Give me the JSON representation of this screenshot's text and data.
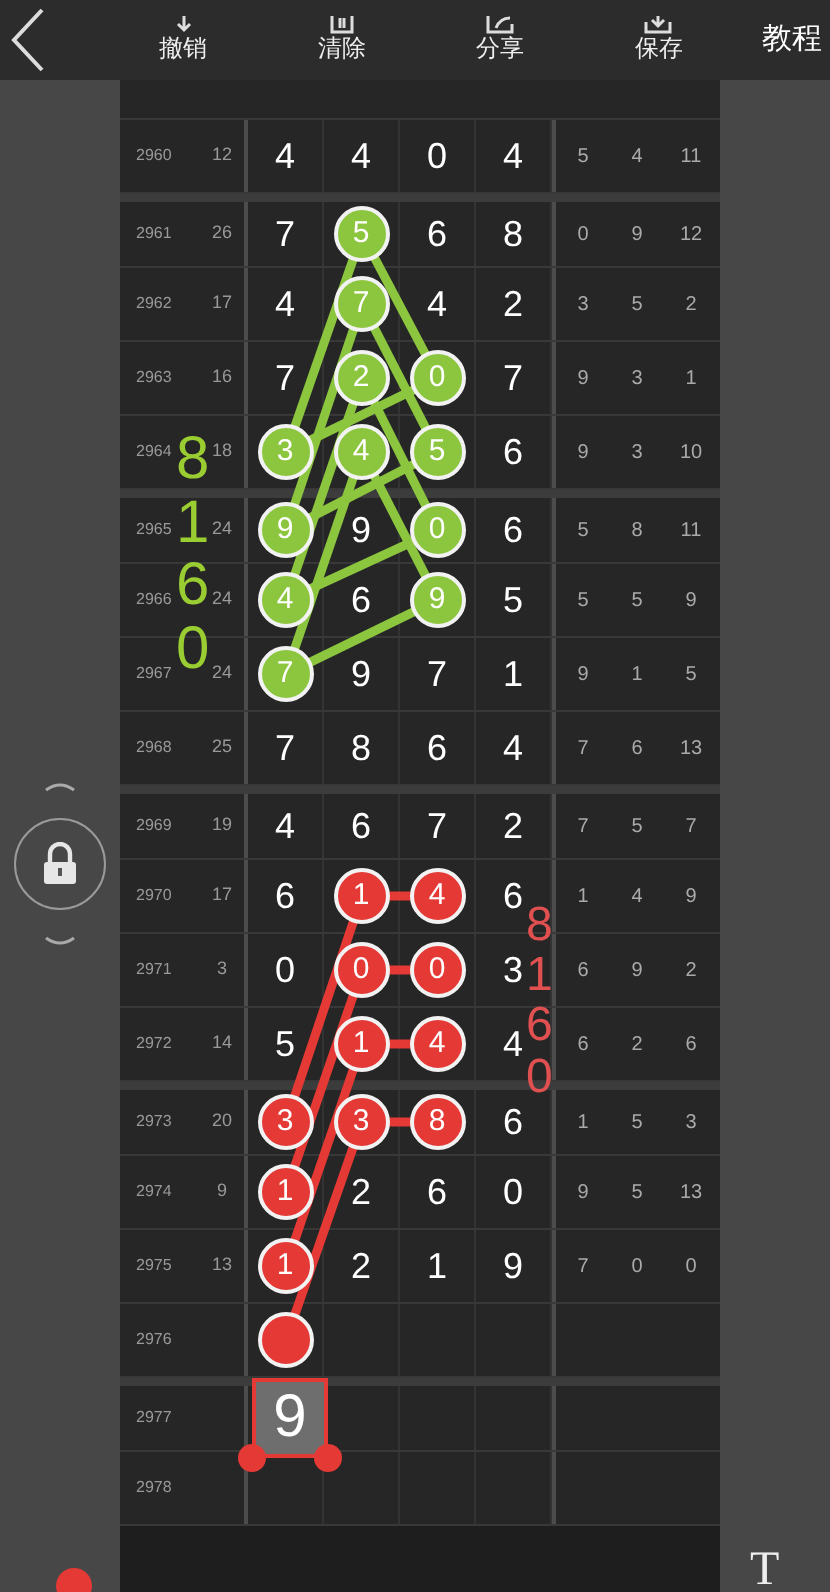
{
  "toolbar": {
    "actions": [
      {
        "label": "撤销",
        "kind": "undo"
      },
      {
        "label": "清除",
        "kind": "clear"
      },
      {
        "label": "分享",
        "kind": "share"
      },
      {
        "label": "保存",
        "kind": "save"
      }
    ],
    "help": "教程"
  },
  "rows": [
    {
      "issue": "2960",
      "sum": "12",
      "digits": [
        {
          "value": "4"
        },
        {
          "value": "4"
        },
        {
          "value": "0"
        },
        {
          "value": "4"
        }
      ],
      "stats": [
        "5",
        "4",
        "11"
      ]
    },
    {
      "issue": "2961",
      "sum": "26",
      "digits": [
        {
          "value": "7"
        },
        {
          "value": "5",
          "color": "#8cc63f"
        },
        {
          "value": "6"
        },
        {
          "value": "8"
        }
      ],
      "stats": [
        "0",
        "9",
        "12"
      ]
    },
    {
      "issue": "2962",
      "sum": "17",
      "digits": [
        {
          "value": "4"
        },
        {
          "value": "7",
          "color": "#8cc63f"
        },
        {
          "value": "4"
        },
        {
          "value": "2"
        }
      ],
      "stats": [
        "3",
        "5",
        "2"
      ]
    },
    {
      "issue": "2963",
      "sum": "16",
      "digits": [
        {
          "value": "7"
        },
        {
          "value": "2",
          "color": "#8cc63f"
        },
        {
          "value": "0",
          "color": "#8cc63f"
        },
        {
          "value": "7"
        }
      ],
      "stats": [
        "9",
        "3",
        "1"
      ]
    },
    {
      "issue": "2964",
      "sum": "18",
      "digits": [
        {
          "value": "3",
          "color": "#8cc63f"
        },
        {
          "value": "4",
          "color": "#8cc63f"
        },
        {
          "value": "5",
          "color": "#8cc63f"
        },
        {
          "value": "6"
        }
      ],
      "stats": [
        "9",
        "3",
        "10"
      ]
    },
    {
      "issue": "2965",
      "sum": "24",
      "digits": [
        {
          "value": "9",
          "color": "#8cc63f"
        },
        {
          "value": "9"
        },
        {
          "value": "0",
          "color": "#8cc63f"
        },
        {
          "value": "6"
        }
      ],
      "stats": [
        "5",
        "8",
        "11"
      ]
    },
    {
      "issue": "2966",
      "sum": "24",
      "digits": [
        {
          "value": "4",
          "color": "#8cc63f"
        },
        {
          "value": "6"
        },
        {
          "value": "9",
          "color": "#8cc63f"
        },
        {
          "value": "5"
        }
      ],
      "stats": [
        "5",
        "5",
        "9"
      ]
    },
    {
      "issue": "2967",
      "sum": "24",
      "digits": [
        {
          "value": "7",
          "color": "#8cc63f"
        },
        {
          "value": "9"
        },
        {
          "value": "7"
        },
        {
          "value": "1"
        }
      ],
      "stats": [
        "9",
        "1",
        "5"
      ]
    },
    {
      "issue": "2968",
      "sum": "25",
      "digits": [
        {
          "value": "7"
        },
        {
          "value": "8"
        },
        {
          "value": "6"
        },
        {
          "value": "4"
        }
      ],
      "stats": [
        "7",
        "6",
        "13"
      ]
    },
    {
      "issue": "2969",
      "sum": "19",
      "digits": [
        {
          "value": "4"
        },
        {
          "value": "6"
        },
        {
          "value": "7"
        },
        {
          "value": "2"
        }
      ],
      "stats": [
        "7",
        "5",
        "7"
      ]
    },
    {
      "issue": "2970",
      "sum": "17",
      "digits": [
        {
          "value": "6"
        },
        {
          "value": "1",
          "color": "#e53935"
        },
        {
          "value": "4",
          "color": "#e53935"
        },
        {
          "value": "6"
        }
      ],
      "stats": [
        "1",
        "4",
        "9"
      ]
    },
    {
      "issue": "2971",
      "sum": "3",
      "digits": [
        {
          "value": "0"
        },
        {
          "value": "0",
          "color": "#e53935"
        },
        {
          "value": "0",
          "color": "#e53935"
        },
        {
          "value": "3"
        }
      ],
      "stats": [
        "6",
        "9",
        "2"
      ]
    },
    {
      "issue": "2972",
      "sum": "14",
      "digits": [
        {
          "value": "5"
        },
        {
          "value": "1",
          "color": "#e53935"
        },
        {
          "value": "4",
          "color": "#e53935"
        },
        {
          "value": "4"
        }
      ],
      "stats": [
        "6",
        "2",
        "6"
      ]
    },
    {
      "issue": "2973",
      "sum": "20",
      "digits": [
        {
          "value": "3",
          "color": "#e53935"
        },
        {
          "value": "3",
          "color": "#e53935"
        },
        {
          "value": "8",
          "color": "#e53935"
        },
        {
          "value": "6"
        }
      ],
      "stats": [
        "1",
        "5",
        "3"
      ]
    },
    {
      "issue": "2974",
      "sum": "9",
      "digits": [
        {
          "value": "1",
          "color": "#e53935"
        },
        {
          "value": "2"
        },
        {
          "value": "6"
        },
        {
          "value": "0"
        }
      ],
      "stats": [
        "9",
        "5",
        "13"
      ]
    },
    {
      "issue": "2975",
      "sum": "13",
      "digits": [
        {
          "value": "1",
          "color": "#e53935"
        },
        {
          "value": "2"
        },
        {
          "value": "1"
        },
        {
          "value": "9"
        }
      ],
      "stats": [
        "7",
        "0",
        "0"
      ]
    },
    {
      "issue": "2976",
      "digits": [
        {
          "color": "#e53935"
        }
      ]
    },
    {
      "issue": "2977"
    },
    {
      "issue": "2978"
    }
  ],
  "annotations": [
    {
      "kind": "vertical_text",
      "text": "8160",
      "color": "#9acd32"
    },
    {
      "kind": "vertical_text",
      "text": "8160",
      "color": "#e05050"
    },
    {
      "kind": "text_box",
      "text": "9",
      "selected": true
    }
  ],
  "side_tools": {
    "lock": {
      "locked": true
    },
    "text_tool": "T"
  }
}
